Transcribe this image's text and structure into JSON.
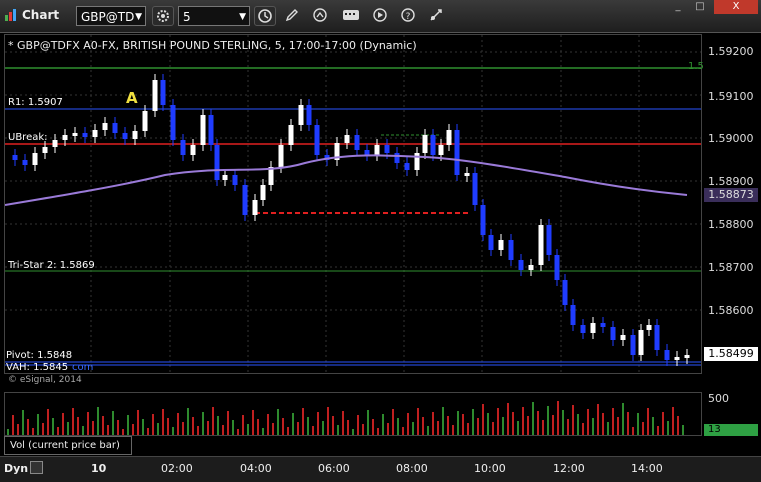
{
  "window": {
    "title": "Chart",
    "symbol": "GBP@TD",
    "interval": "5",
    "min_label": "_",
    "max_label": "□",
    "close_label": "X"
  },
  "toolbar": {
    "icons": [
      "refresh-icon",
      "pencil-icon",
      "cursor-icon",
      "hot-keys-icon",
      "play-icon",
      "help-icon",
      "link-icon"
    ]
  },
  "chart": {
    "header": "* GBP@TDFX A0-FX, BRITISH POUND STERLING, 5, 17:00-17:00 (Dynamic)",
    "marker_a": "A",
    "levels": {
      "r1": "R1: 1.5907",
      "ubreak": "UBreak:",
      "tristar": "Tri-Star 2: 1.5869",
      "pivot": "Pivot: 1.5848",
      "vah": "VAH: 1.5845",
      "vah_suffix": "com",
      "green_top_suffix": "1.5"
    },
    "copyright": "© eSignal, 2014",
    "price_axis": [
      "1.59200",
      "1.59100",
      "1.59000",
      "1.58900",
      "1.58800",
      "1.58700",
      "1.58600"
    ],
    "current_price": "1.58499",
    "ma_price": "1.58873",
    "time_axis": [
      "10",
      "02:00",
      "04:00",
      "06:00",
      "08:00",
      "10:00",
      "12:00",
      "14:00"
    ],
    "bottom_left": "Dyn",
    "colors": {
      "bull": "#ffffff",
      "bear": "#1f3cff",
      "ma": "#9a7ad8",
      "pivot_line": "#2a55ff",
      "ubreak_line": "#e02020",
      "green_line": "#2f8f2f",
      "vol_up": "#2e8b2e",
      "vol_down": "#c02020"
    }
  },
  "volume": {
    "label": "Vol (current price bar)",
    "axis_value": "500",
    "current_value": "13"
  }
}
